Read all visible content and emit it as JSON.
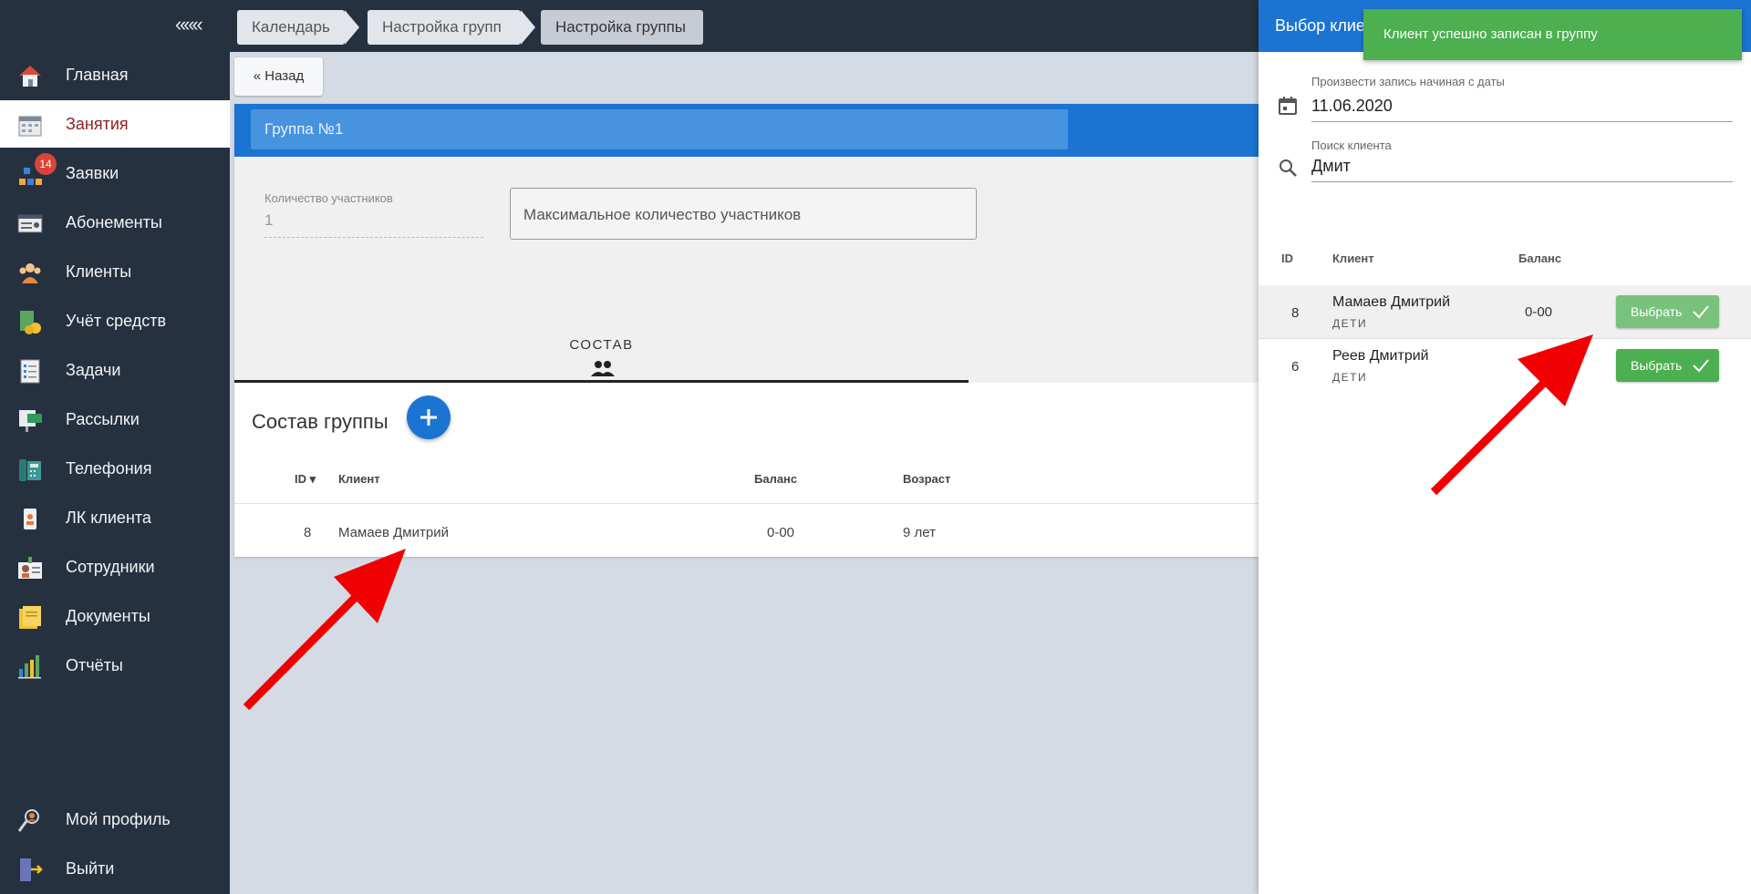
{
  "sidebar": {
    "collapse_label": "«««",
    "items": [
      {
        "label": "Главная",
        "icon": "home-icon"
      },
      {
        "label": "Занятия",
        "icon": "calendar-icon"
      },
      {
        "label": "Заявки",
        "icon": "requests-icon",
        "badge": "14"
      },
      {
        "label": "Абонементы",
        "icon": "subscription-icon"
      },
      {
        "label": "Клиенты",
        "icon": "clients-icon"
      },
      {
        "label": "Учёт средств",
        "icon": "money-icon"
      },
      {
        "label": "Задачи",
        "icon": "tasks-icon"
      },
      {
        "label": "Рассылки",
        "icon": "mailing-icon"
      },
      {
        "label": "Телефония",
        "icon": "phone-icon"
      },
      {
        "label": "ЛК клиента",
        "icon": "client-account-icon"
      },
      {
        "label": "Сотрудники",
        "icon": "staff-icon"
      },
      {
        "label": "Документы",
        "icon": "documents-icon"
      },
      {
        "label": "Отчёты",
        "icon": "reports-icon"
      }
    ],
    "bottom_items": [
      {
        "label": "Мой профиль",
        "icon": "profile-icon"
      },
      {
        "label": "Выйти",
        "icon": "logout-icon"
      }
    ]
  },
  "breadcrumb": [
    "Календарь",
    "Настройка групп",
    "Настройка группы"
  ],
  "back_button": "« Назад",
  "group": {
    "name": "Группа №1",
    "count_label": "Количество участников",
    "count_value": "1",
    "max_placeholder": "Максимальное количество участников"
  },
  "tab": {
    "label": "СОСТАВ",
    "icon": "group-icon"
  },
  "composition": {
    "title": "Состав группы",
    "headers": {
      "id": "ID",
      "client": "Клиент",
      "balance": "Баланс",
      "age": "Возраст"
    },
    "rows": [
      {
        "id": "8",
        "client": "Мамаев Дмитрий",
        "balance": "0-00",
        "age": "9 лет"
      }
    ]
  },
  "panel": {
    "title": "Выбор клиен",
    "toast": "Клиент успешно записан в группу",
    "date_label": "Произвести запись начиная с даты",
    "date_value": "11.06.2020",
    "search_label": "Поиск клиента",
    "search_value": "Дмит",
    "headers": {
      "id": "ID",
      "client": "Клиент",
      "balance": "Баланс"
    },
    "rows": [
      {
        "id": "8",
        "name": "Мамаев Дмитрий",
        "sub": "ДЕТИ",
        "balance": "0-00",
        "button": "Выбрать"
      },
      {
        "id": "6",
        "name": "Реев Дмитрий",
        "sub": "ДЕТИ",
        "balance": "",
        "button": "Выбрать"
      }
    ]
  },
  "colors": {
    "accent": "#1b74d1",
    "success": "#4caf50",
    "sidebar": "#263140",
    "arrow": "#f00000"
  }
}
